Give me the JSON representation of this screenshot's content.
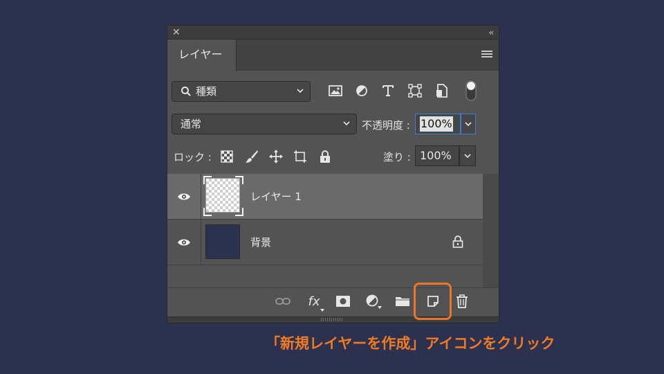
{
  "panel": {
    "close_glyph": "✕",
    "collapse_glyph": "‹‹",
    "tab_label": "レイヤー"
  },
  "filter": {
    "kind_label": "種類",
    "icons": [
      "image-filter-icon",
      "adjustment-filter-icon",
      "type-filter-icon",
      "shape-filter-icon",
      "smart-object-filter-icon",
      "filter-toggle-icon"
    ]
  },
  "blend": {
    "mode": "通常",
    "opacity_label": "不透明度 :",
    "opacity_value": "100%"
  },
  "lock": {
    "label": "ロック :",
    "icons": [
      "lock-transparency-icon",
      "lock-pixels-icon",
      "lock-position-icon",
      "lock-artboard-icon",
      "lock-all-icon"
    ],
    "fill_label": "塗り :",
    "fill_value": "100%"
  },
  "layers": [
    {
      "name": "レイヤー 1",
      "selected": true,
      "locked": false
    },
    {
      "name": "背景",
      "selected": false,
      "locked": true
    }
  ],
  "footer": {
    "icons": [
      "link-layers-icon",
      "fx-icon",
      "layer-mask-icon",
      "adjustment-layer-icon",
      "new-group-icon",
      "new-layer-icon",
      "delete-layer-icon"
    ],
    "fx_label": "fx"
  },
  "caption": "「新規レイヤーを作成」アイコンをクリック",
  "colors": {
    "background": "#2c3150",
    "panel": "#535353",
    "highlight": "#e8792a",
    "caption": "#f07b22",
    "background_layer_fill": "#2c3150"
  }
}
